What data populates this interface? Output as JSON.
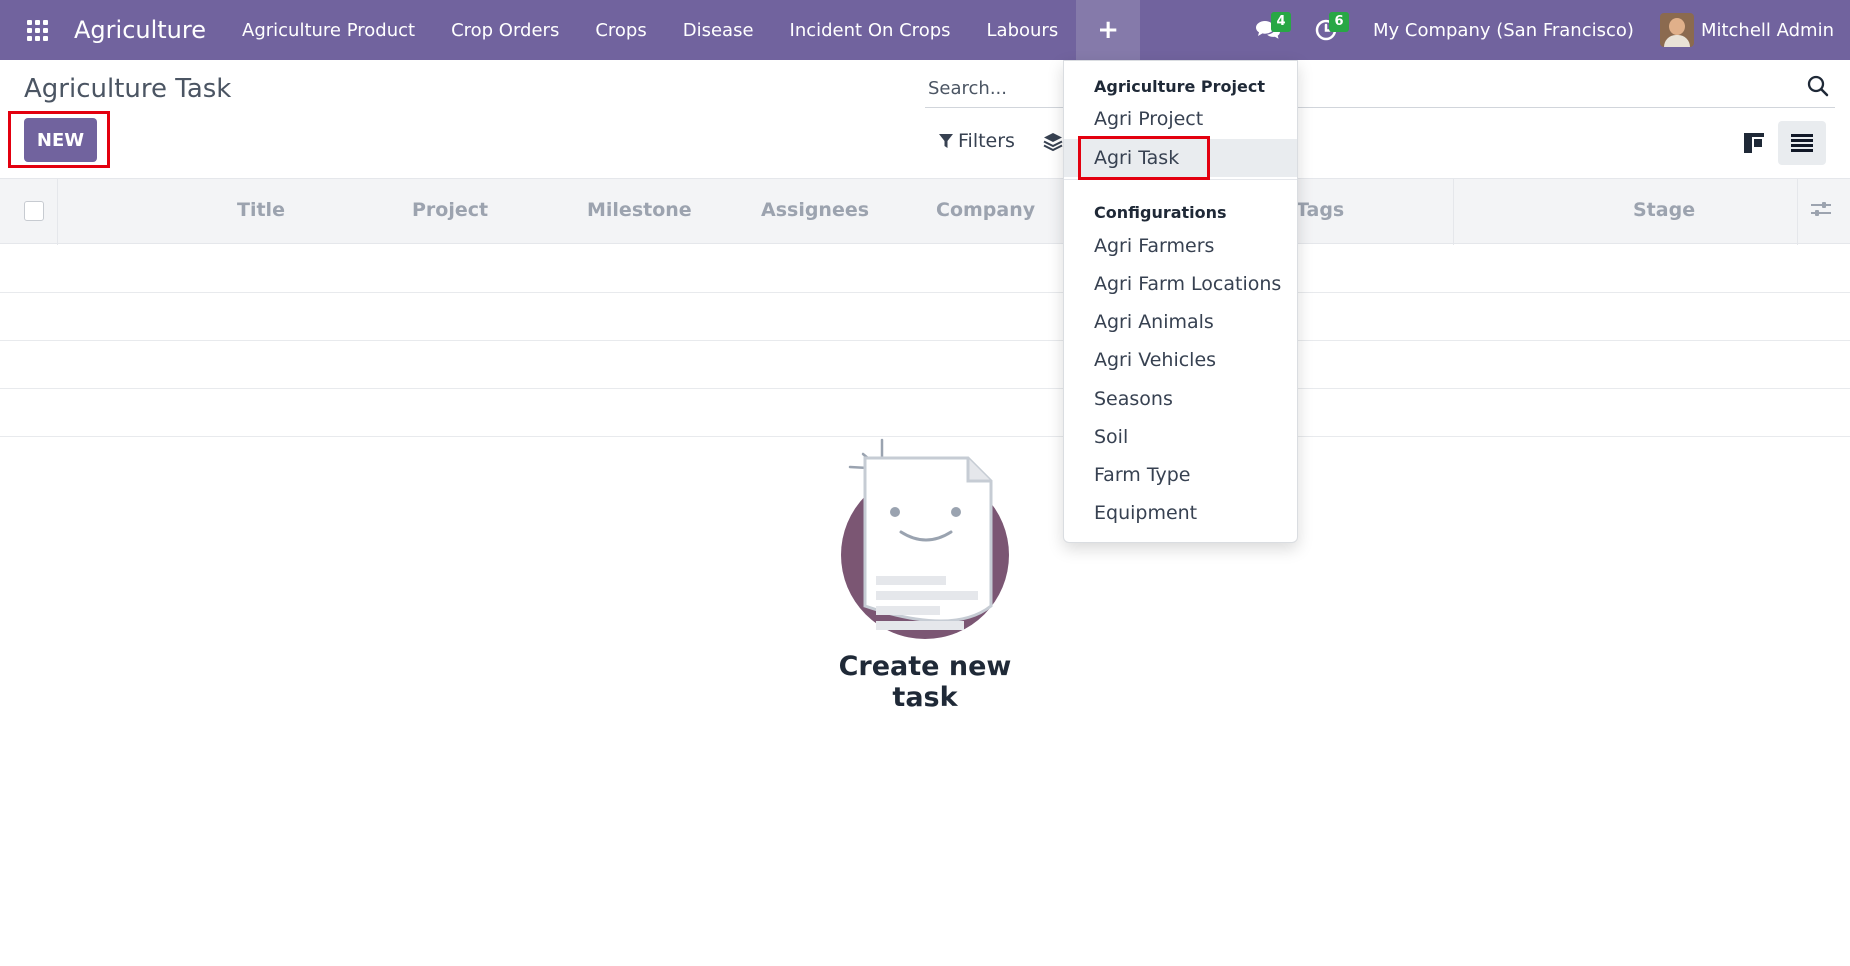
{
  "navbar": {
    "brand": "Agriculture",
    "menu": [
      "Agriculture Product",
      "Crop Orders",
      "Crops",
      "Disease",
      "Incident On Crops",
      "Labours"
    ],
    "plus_label": "+",
    "messages_count": "4",
    "activities_count": "6",
    "company": "My Company (San Francisco)",
    "user": "Mitchell Admin"
  },
  "control_panel": {
    "title": "Agriculture Task",
    "new_label": "NEW",
    "search_placeholder": "Search...",
    "filters_label": "Filters"
  },
  "table": {
    "columns": [
      "Title",
      "Project",
      "Milestone",
      "Assignees",
      "Company",
      "Tags",
      "Stage"
    ]
  },
  "empty_state": {
    "title": "Create new task"
  },
  "dropdown": {
    "section1_header": "Agriculture Project",
    "section1_items": [
      "Agri Project",
      "Agri Task"
    ],
    "section2_header": "Configurations",
    "section2_items": [
      "Agri Farmers",
      "Agri Farm Locations",
      "Agri Animals",
      "Agri Vehicles",
      "Seasons",
      "Soil",
      "Farm Type",
      "Equipment"
    ]
  },
  "colors": {
    "brand": "#71639e",
    "badge": "#28a745",
    "highlight": "#e3000f"
  }
}
